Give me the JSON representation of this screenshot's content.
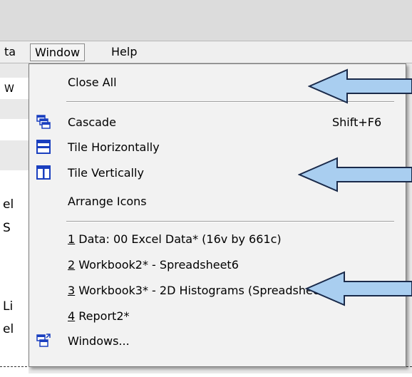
{
  "menubar": {
    "prev_label": "ta",
    "window_label": "Window",
    "help_label": "Help"
  },
  "background": {
    "toolbar_label": "W",
    "left_fragments": [
      "el",
      "S",
      "Li",
      "el"
    ]
  },
  "window_menu": {
    "close_all": "Close All",
    "cascade": "Cascade",
    "cascade_shortcut": "Shift+F6",
    "tile_horizontally": "Tile Horizontally",
    "tile_vertically": "Tile Vertically",
    "arrange_icons": "Arrange Icons",
    "windows": [
      {
        "num": "1",
        "title": " Data: 00 Excel Data* (16v by 661c)"
      },
      {
        "num": "2",
        "title": " Workbook2* - Spreadsheet6"
      },
      {
        "num": "3",
        "title": " Workbook3* - 2D Histograms (Spreadsheet..."
      },
      {
        "num": "4",
        "title": " Report2*"
      }
    ],
    "windows_item": "Windows..."
  },
  "colors": {
    "arrow_fill": "#a9cef0",
    "arrow_stroke": "#1a2a4a",
    "icon_blue": "#1a3fbf"
  }
}
